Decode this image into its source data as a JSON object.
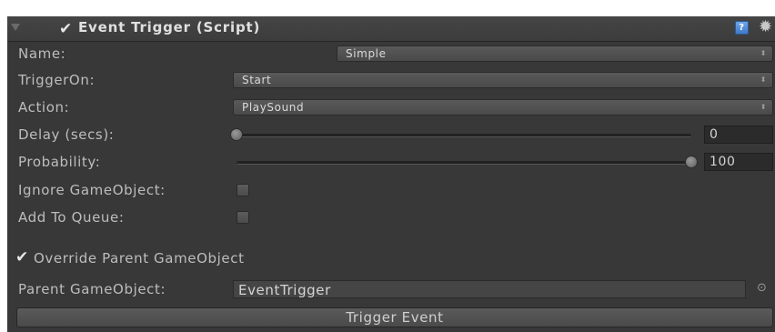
{
  "header": {
    "title": "Event Trigger (Script)",
    "enabled": true,
    "help_icon": "?",
    "settings_icon": "gear-icon"
  },
  "fields": {
    "name": {
      "label": "Name:",
      "value": "Simple"
    },
    "trigger_on": {
      "label": "TriggerOn:",
      "value": "Start"
    },
    "action": {
      "label": "Action:",
      "value": "PlaySound"
    },
    "delay": {
      "label": "Delay (secs):",
      "value": "0",
      "slider_fraction": 0.0
    },
    "probability": {
      "label": "Probability:",
      "value": "100",
      "slider_fraction": 1.0
    },
    "ignore_gameobject": {
      "label": "Ignore GameObject:",
      "checked": false
    },
    "add_to_queue": {
      "label": "Add To Queue:",
      "checked": false
    },
    "override_parent": {
      "label": "Override Parent GameObject",
      "checked": true
    },
    "parent_gameobject": {
      "label": "Parent GameObject:",
      "value": "EventTrigger"
    }
  },
  "buttons": {
    "trigger_event": "Trigger Event"
  },
  "colors": {
    "panel_bg": "#383838",
    "text": "#bdbdbd"
  }
}
